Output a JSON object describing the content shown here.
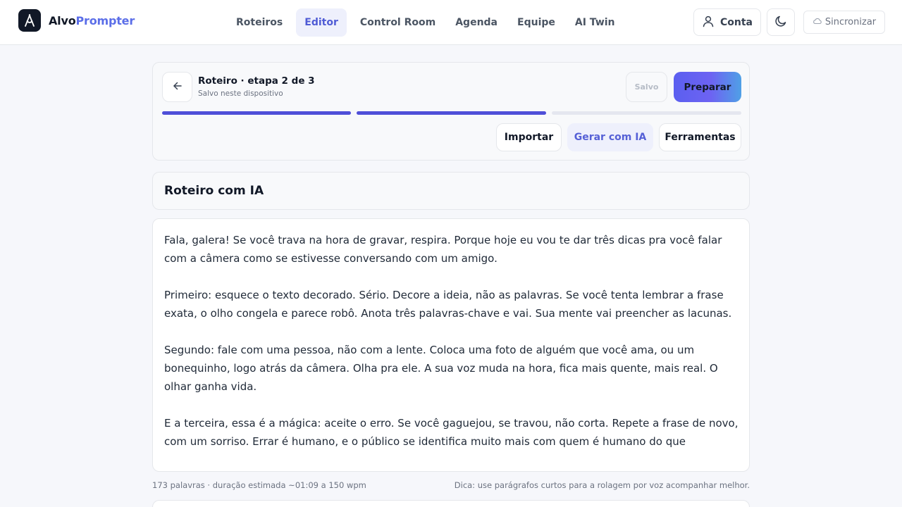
{
  "brand": {
    "name_part1": "Alvo",
    "name_part2": "Prompter",
    "accent": "#5b6ee8"
  },
  "nav": {
    "items": [
      {
        "label": "Roteiros"
      },
      {
        "label": "Editor",
        "active": true
      },
      {
        "label": "Control Room"
      },
      {
        "label": "Agenda"
      },
      {
        "label": "Equipe"
      },
      {
        "label": "AI Twin"
      }
    ]
  },
  "header": {
    "account_label": "Conta",
    "sync_label": "Sincronizar"
  },
  "step": {
    "title": "Roteiro · etapa 2 de 3",
    "subtitle": "Salvo neste dispositivo",
    "saved_label": "Salvo",
    "prepare_label": "Preparar",
    "current_step": 2,
    "total_steps": 3,
    "done_color": "#4f4fd8",
    "pending_color": "#e5e7ef"
  },
  "toolbar": {
    "import_label": "Importar",
    "ai_label": "Gerar com IA",
    "tools_label": "Ferramentas"
  },
  "script_title": "Roteiro com IA",
  "script": {
    "paragraphs": [
      "Fala, galera! Se você trava na hora de gravar, respira. Porque hoje eu vou te dar três dicas pra você falar com a câmera como se estivesse conversando com um amigo.",
      "Primeiro: esquece o texto decorado. Sério. Decore a ideia, não as palavras. Se você tenta lembrar a frase exata, o olho congela e parece robô. Anota três palavras-chave e vai. Sua mente vai preencher as lacunas.",
      "Segundo: fale com uma pessoa, não com a lente. Coloca uma foto de alguém que você ama, ou um bonequinho, logo atrás da câmera. Olha pra ele. A sua voz muda na hora, fica mais quente, mais real. O olhar ganha vida.",
      "E a terceira, essa é a mágica: aceite o erro. Se você gaguejou, se travou, não corta. Repete a frase de novo, com um sorriso. Errar é humano, e o público se identifica muito mais com quem é humano do que"
    ]
  },
  "footer": {
    "stats": "173 palavras · duração estimada ~01:09 a 150 wpm",
    "tip": "Dica: use parágrafos curtos para a rolagem por voz acompanhar melhor."
  }
}
